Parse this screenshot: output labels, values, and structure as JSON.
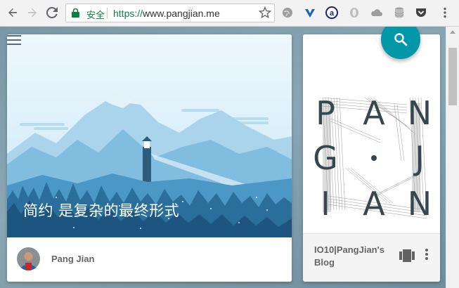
{
  "browser": {
    "secure_label": "安全",
    "url_scheme": "https://",
    "url_host": "www.pangjian.me",
    "extensions": [
      "globe-icon",
      "v-shield-icon",
      "adblock-icon",
      "opera-icon",
      "cloud-icon",
      "database-icon",
      "pocket-icon"
    ]
  },
  "hero": {
    "title": "简约 是复杂的最终形式"
  },
  "author": {
    "name": "Pang Jian"
  },
  "side_card": {
    "logo_letters": [
      "P",
      "A",
      "N",
      "G",
      "J",
      "I",
      "I",
      "A",
      "N"
    ],
    "blog_title": "IO10|PangJian's Blog"
  },
  "colors": {
    "accent": "#0097a7",
    "secure_green": "#0b8043",
    "logo_text": "#37474f"
  }
}
